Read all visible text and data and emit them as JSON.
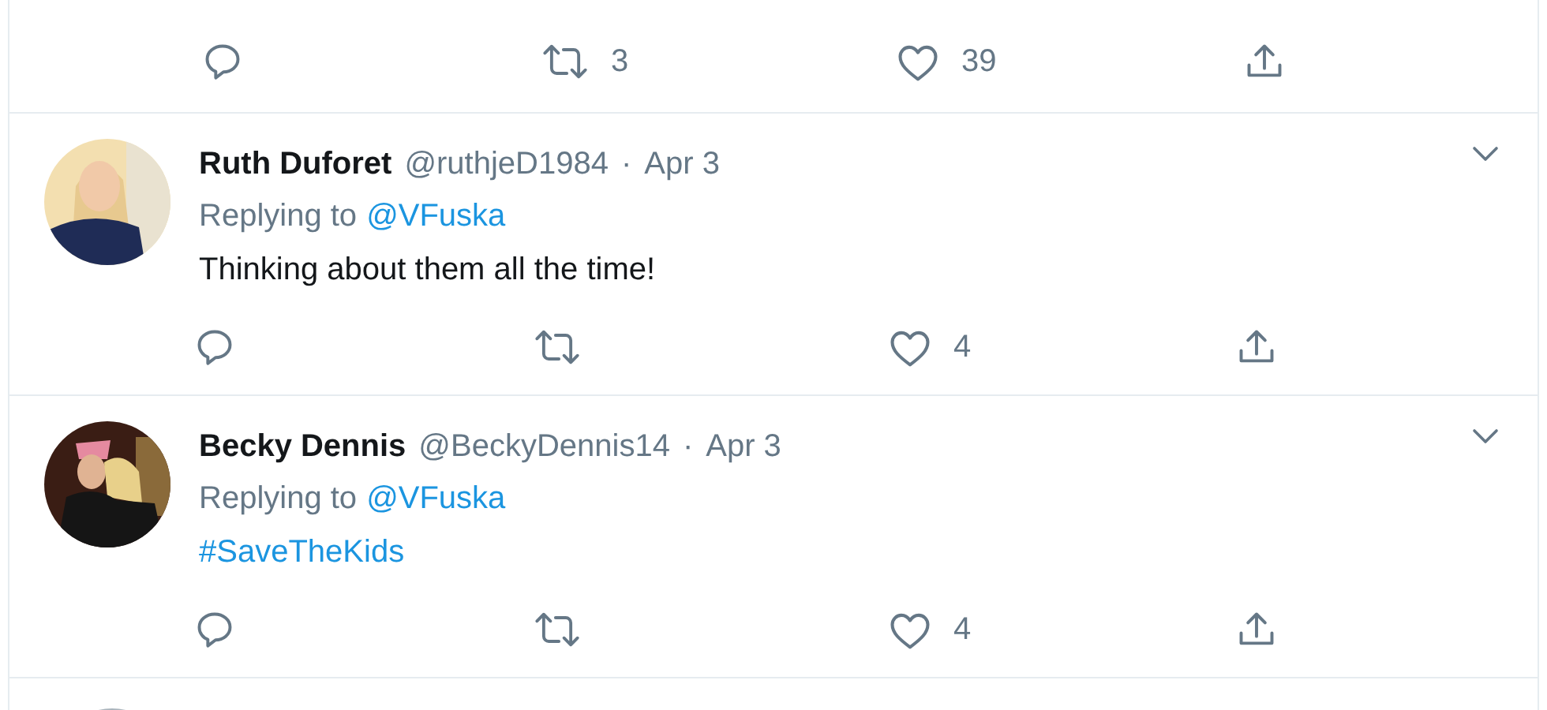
{
  "top_tweet": {
    "actions": {
      "retweets": "3",
      "likes": "39"
    }
  },
  "replies": [
    {
      "name": "Ruth Duforet",
      "handle": "@ruthjeD1984",
      "separator": "·",
      "date": "Apr 3",
      "replying_label": "Replying to",
      "replying_to": "@VFuska",
      "body": {
        "kind": "text",
        "text": "Thinking about them all the time!"
      },
      "actions": {
        "likes": "4"
      }
    },
    {
      "name": "Becky Dennis",
      "handle": "@BeckyDennis14",
      "separator": "·",
      "date": "Apr 3",
      "replying_label": "Replying to",
      "replying_to": "@VFuska",
      "body": {
        "kind": "hashtag",
        "text": "#SaveTheKids"
      },
      "actions": {
        "likes": "4"
      }
    }
  ]
}
